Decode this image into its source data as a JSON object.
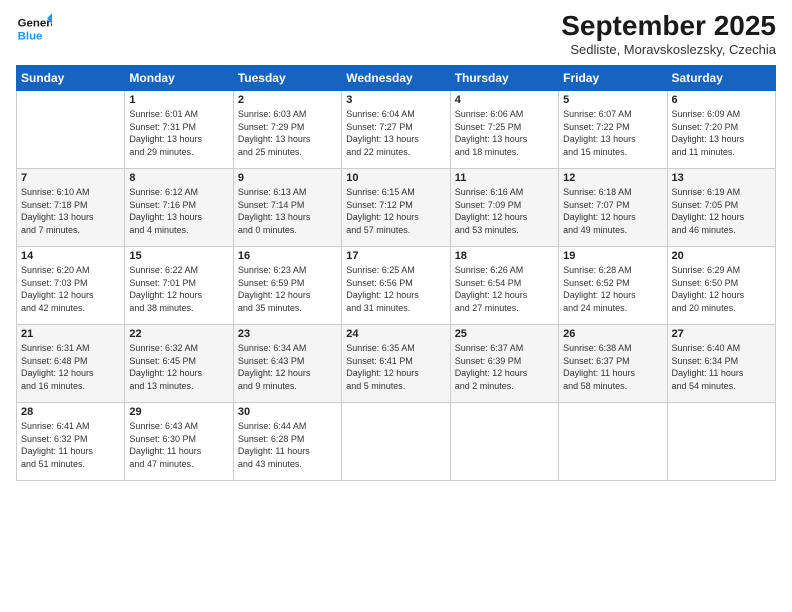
{
  "header": {
    "logo_line1": "General",
    "logo_line2": "Blue",
    "month": "September 2025",
    "location": "Sedliste, Moravskoslezsky, Czechia"
  },
  "days_of_week": [
    "Sunday",
    "Monday",
    "Tuesday",
    "Wednesday",
    "Thursday",
    "Friday",
    "Saturday"
  ],
  "weeks": [
    [
      {
        "day": "",
        "info": ""
      },
      {
        "day": "1",
        "info": "Sunrise: 6:01 AM\nSunset: 7:31 PM\nDaylight: 13 hours\nand 29 minutes."
      },
      {
        "day": "2",
        "info": "Sunrise: 6:03 AM\nSunset: 7:29 PM\nDaylight: 13 hours\nand 25 minutes."
      },
      {
        "day": "3",
        "info": "Sunrise: 6:04 AM\nSunset: 7:27 PM\nDaylight: 13 hours\nand 22 minutes."
      },
      {
        "day": "4",
        "info": "Sunrise: 6:06 AM\nSunset: 7:25 PM\nDaylight: 13 hours\nand 18 minutes."
      },
      {
        "day": "5",
        "info": "Sunrise: 6:07 AM\nSunset: 7:22 PM\nDaylight: 13 hours\nand 15 minutes."
      },
      {
        "day": "6",
        "info": "Sunrise: 6:09 AM\nSunset: 7:20 PM\nDaylight: 13 hours\nand 11 minutes."
      }
    ],
    [
      {
        "day": "7",
        "info": "Sunrise: 6:10 AM\nSunset: 7:18 PM\nDaylight: 13 hours\nand 7 minutes."
      },
      {
        "day": "8",
        "info": "Sunrise: 6:12 AM\nSunset: 7:16 PM\nDaylight: 13 hours\nand 4 minutes."
      },
      {
        "day": "9",
        "info": "Sunrise: 6:13 AM\nSunset: 7:14 PM\nDaylight: 13 hours\nand 0 minutes."
      },
      {
        "day": "10",
        "info": "Sunrise: 6:15 AM\nSunset: 7:12 PM\nDaylight: 12 hours\nand 57 minutes."
      },
      {
        "day": "11",
        "info": "Sunrise: 6:16 AM\nSunset: 7:09 PM\nDaylight: 12 hours\nand 53 minutes."
      },
      {
        "day": "12",
        "info": "Sunrise: 6:18 AM\nSunset: 7:07 PM\nDaylight: 12 hours\nand 49 minutes."
      },
      {
        "day": "13",
        "info": "Sunrise: 6:19 AM\nSunset: 7:05 PM\nDaylight: 12 hours\nand 46 minutes."
      }
    ],
    [
      {
        "day": "14",
        "info": "Sunrise: 6:20 AM\nSunset: 7:03 PM\nDaylight: 12 hours\nand 42 minutes."
      },
      {
        "day": "15",
        "info": "Sunrise: 6:22 AM\nSunset: 7:01 PM\nDaylight: 12 hours\nand 38 minutes."
      },
      {
        "day": "16",
        "info": "Sunrise: 6:23 AM\nSunset: 6:59 PM\nDaylight: 12 hours\nand 35 minutes."
      },
      {
        "day": "17",
        "info": "Sunrise: 6:25 AM\nSunset: 6:56 PM\nDaylight: 12 hours\nand 31 minutes."
      },
      {
        "day": "18",
        "info": "Sunrise: 6:26 AM\nSunset: 6:54 PM\nDaylight: 12 hours\nand 27 minutes."
      },
      {
        "day": "19",
        "info": "Sunrise: 6:28 AM\nSunset: 6:52 PM\nDaylight: 12 hours\nand 24 minutes."
      },
      {
        "day": "20",
        "info": "Sunrise: 6:29 AM\nSunset: 6:50 PM\nDaylight: 12 hours\nand 20 minutes."
      }
    ],
    [
      {
        "day": "21",
        "info": "Sunrise: 6:31 AM\nSunset: 6:48 PM\nDaylight: 12 hours\nand 16 minutes."
      },
      {
        "day": "22",
        "info": "Sunrise: 6:32 AM\nSunset: 6:45 PM\nDaylight: 12 hours\nand 13 minutes."
      },
      {
        "day": "23",
        "info": "Sunrise: 6:34 AM\nSunset: 6:43 PM\nDaylight: 12 hours\nand 9 minutes."
      },
      {
        "day": "24",
        "info": "Sunrise: 6:35 AM\nSunset: 6:41 PM\nDaylight: 12 hours\nand 5 minutes."
      },
      {
        "day": "25",
        "info": "Sunrise: 6:37 AM\nSunset: 6:39 PM\nDaylight: 12 hours\nand 2 minutes."
      },
      {
        "day": "26",
        "info": "Sunrise: 6:38 AM\nSunset: 6:37 PM\nDaylight: 11 hours\nand 58 minutes."
      },
      {
        "day": "27",
        "info": "Sunrise: 6:40 AM\nSunset: 6:34 PM\nDaylight: 11 hours\nand 54 minutes."
      }
    ],
    [
      {
        "day": "28",
        "info": "Sunrise: 6:41 AM\nSunset: 6:32 PM\nDaylight: 11 hours\nand 51 minutes."
      },
      {
        "day": "29",
        "info": "Sunrise: 6:43 AM\nSunset: 6:30 PM\nDaylight: 11 hours\nand 47 minutes."
      },
      {
        "day": "30",
        "info": "Sunrise: 6:44 AM\nSunset: 6:28 PM\nDaylight: 11 hours\nand 43 minutes."
      },
      {
        "day": "",
        "info": ""
      },
      {
        "day": "",
        "info": ""
      },
      {
        "day": "",
        "info": ""
      },
      {
        "day": "",
        "info": ""
      }
    ]
  ]
}
